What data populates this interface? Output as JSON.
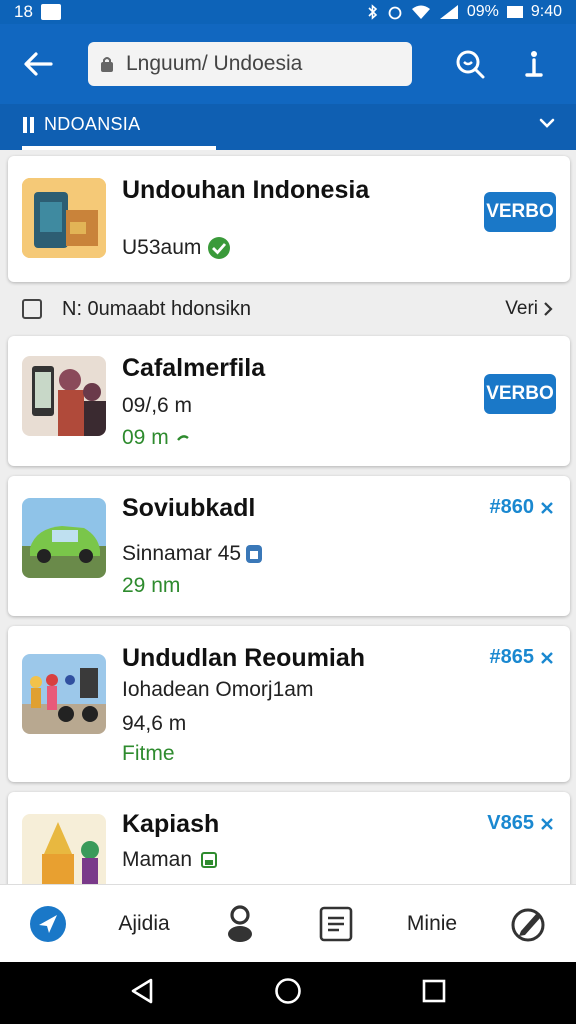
{
  "status_bar": {
    "left_text": "18",
    "battery": "09%",
    "time": "9:40"
  },
  "browser": {
    "url_text": "Lnguum/ Undoesia"
  },
  "tab": {
    "label": "NDOANSIA"
  },
  "featured": {
    "title": "Undouhan Indonesia",
    "subtitle": "U53aum",
    "button": "VERBO"
  },
  "selection_row": {
    "label": "N: 0umaabt hdonsikn",
    "more_label": "Veri"
  },
  "items": [
    {
      "title": "Cafalmerfila",
      "line1": "09/,6 m",
      "line2": "09 m",
      "action": "VERBO",
      "action_type": "button"
    },
    {
      "title": "Soviubkadl",
      "line1": "Sinnamar 45",
      "line2": "29 nm",
      "action": "#860",
      "action_type": "download"
    },
    {
      "title": "Undudlan Reoumiah",
      "line1": "Iohadean Omorj1am",
      "line2": "94,6 m",
      "line3": "Fitme",
      "action": "#865",
      "action_type": "download"
    },
    {
      "title": "Kapiash",
      "line1": "Maman",
      "line2": "",
      "action": "V865",
      "action_type": "download"
    }
  ],
  "bottom_nav": {
    "item1": "Ajidia",
    "item2": "Minie"
  },
  "colors": {
    "primary": "#1167c0",
    "accent_button": "#1a78c8",
    "green": "#2e8b2e"
  }
}
